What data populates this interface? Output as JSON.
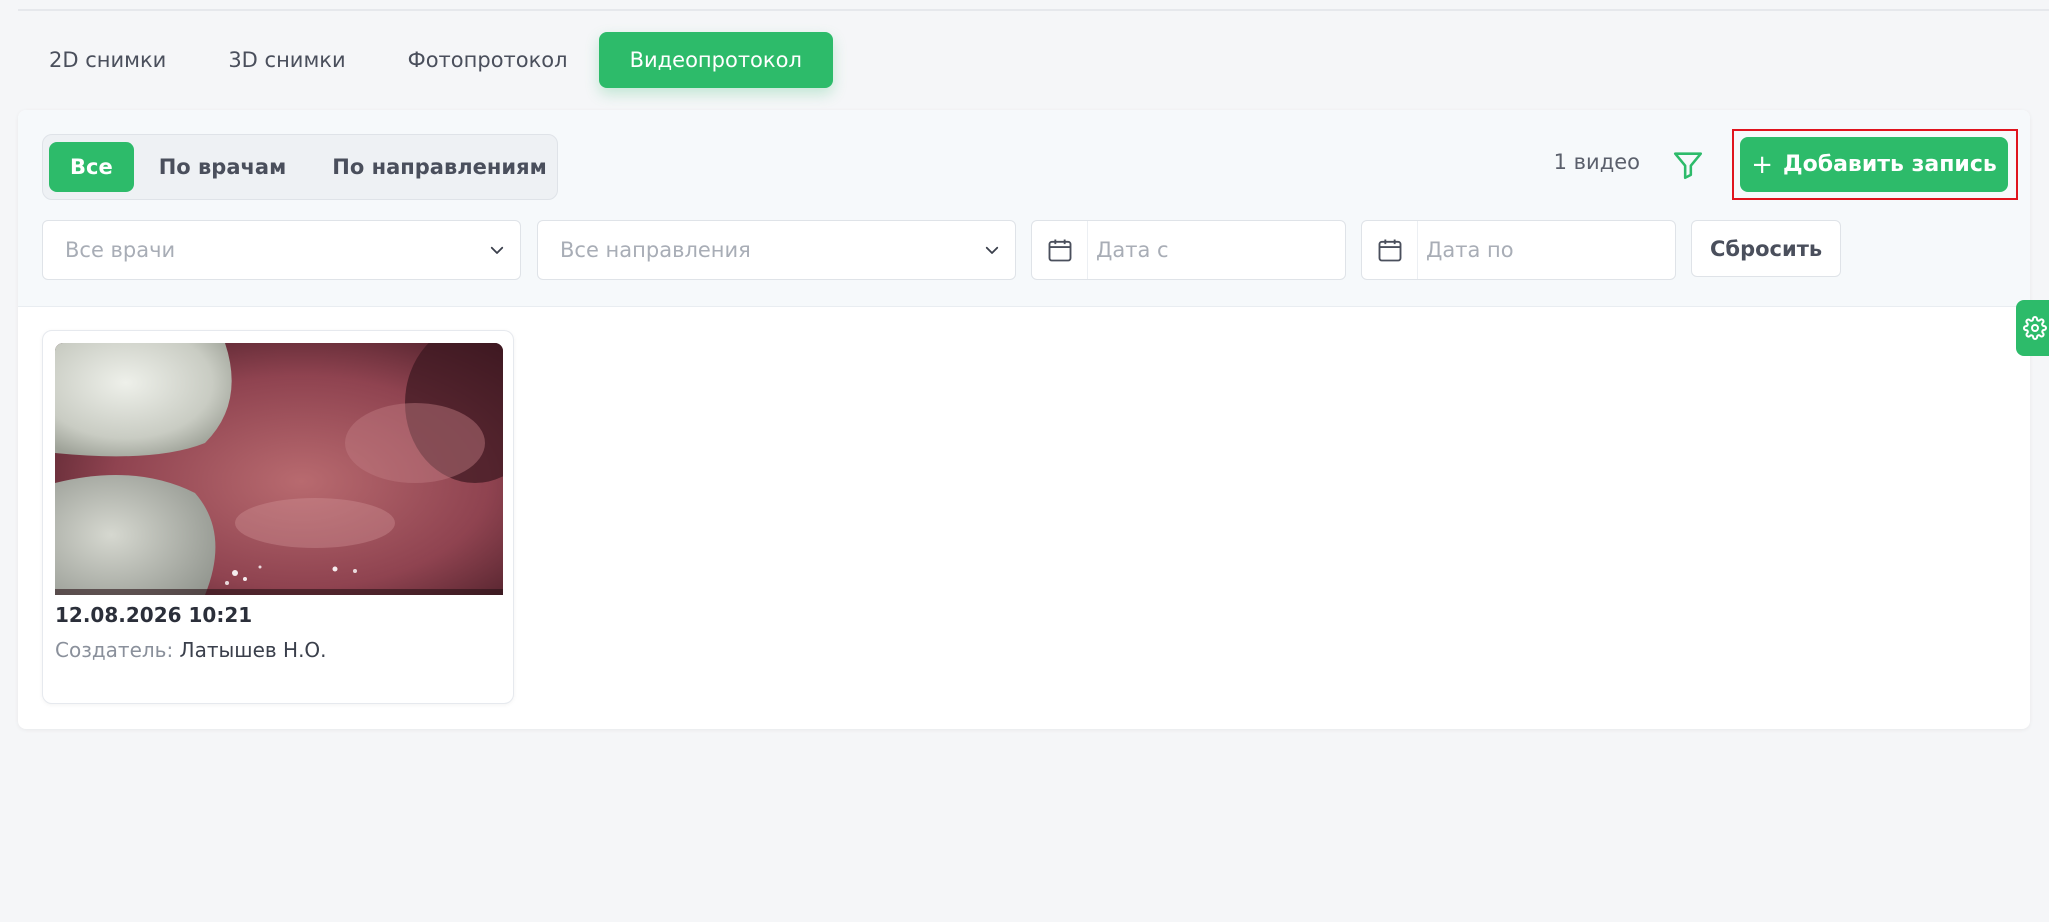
{
  "tabs": [
    {
      "label": "2D снимки",
      "active": false
    },
    {
      "label": "3D снимки",
      "active": false
    },
    {
      "label": "Фотопротокол",
      "active": false
    },
    {
      "label": "Видеопротокол",
      "active": true
    }
  ],
  "segments": [
    {
      "label": "Все",
      "active": true
    },
    {
      "label": "По врачам",
      "active": false
    },
    {
      "label": "По направлениям",
      "active": false
    }
  ],
  "video_count": "1 видео",
  "add_button": {
    "plus": "+",
    "label": "Добавить запись"
  },
  "filters": {
    "doctors": "Все врачи",
    "directions": "Все направления",
    "date_from": "Дата с",
    "date_to": "Дата по",
    "reset": "Сбросить"
  },
  "videos": [
    {
      "datetime": "12.08.2026 10:21",
      "creator_label": "Создатель:",
      "creator": "Латышев Н.О."
    }
  ],
  "icons": {
    "filter": "filter-icon",
    "calendar": "calendar-icon",
    "chevron": "chevron-down-icon",
    "settings": "gear-icon"
  },
  "colors": {
    "accent": "#2dbb6a",
    "highlight_outline": "#e0141e",
    "background": "#f5f6f8"
  }
}
